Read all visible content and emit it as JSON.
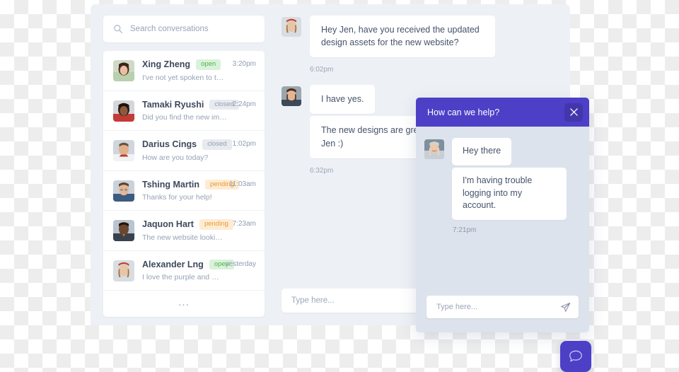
{
  "search": {
    "placeholder": "Search conversations",
    "value": "",
    "icon": "search-icon"
  },
  "conversations": [
    {
      "name": "Xing Zheng",
      "status": "open",
      "time": "3:20pm",
      "preview": "I've not yet spoken to them..."
    },
    {
      "name": "Tamaki Ryushi",
      "status": "closed",
      "time": "2:24pm",
      "preview": "Did you find the new images..."
    },
    {
      "name": "Darius Cings",
      "status": "closed",
      "time": "1:02pm",
      "preview": "How are you today?"
    },
    {
      "name": "Tshing Martin",
      "status": "pending",
      "time": "11:03am",
      "preview": "Thanks for your help!"
    },
    {
      "name": "Jaquon Hart",
      "status": "pending",
      "time": "7:23am",
      "preview": "The new website looking rea..."
    },
    {
      "name": "Alexander Lng",
      "status": "open",
      "time": "yesterday",
      "preview": "I love the purple and gol..."
    }
  ],
  "conversation_list_more": "...",
  "chat": {
    "groups": [
      {
        "messages": [
          "Hey Jen, have you received the updated design assets for the new website?"
        ],
        "time": "6:02pm"
      },
      {
        "messages": [
          "I have yes.",
          "The new designs are great! Well done Jen :)"
        ],
        "time": "6:32pm"
      }
    ],
    "input_placeholder": "Type here...",
    "input_value": ""
  },
  "widget": {
    "title": "How can we help?",
    "close_icon": "close-icon",
    "messages": [
      "Hey there",
      "I'm having trouble logging into my account."
    ],
    "time": "7:21pm",
    "input_placeholder": "Type here...",
    "input_value": "",
    "send_icon": "send-icon",
    "accent": "#4d3fc6"
  },
  "launcher": {
    "icon": "chat-bubble-icon",
    "color": "#4d3fc6"
  },
  "badge_colors": {
    "open_bg": "#d9f2d9",
    "open_fg": "#4fb34f",
    "closed_bg": "#e7eaef",
    "closed_fg": "#93a0b2",
    "pending_bg": "#fdecd4",
    "pending_fg": "#f0962e"
  }
}
